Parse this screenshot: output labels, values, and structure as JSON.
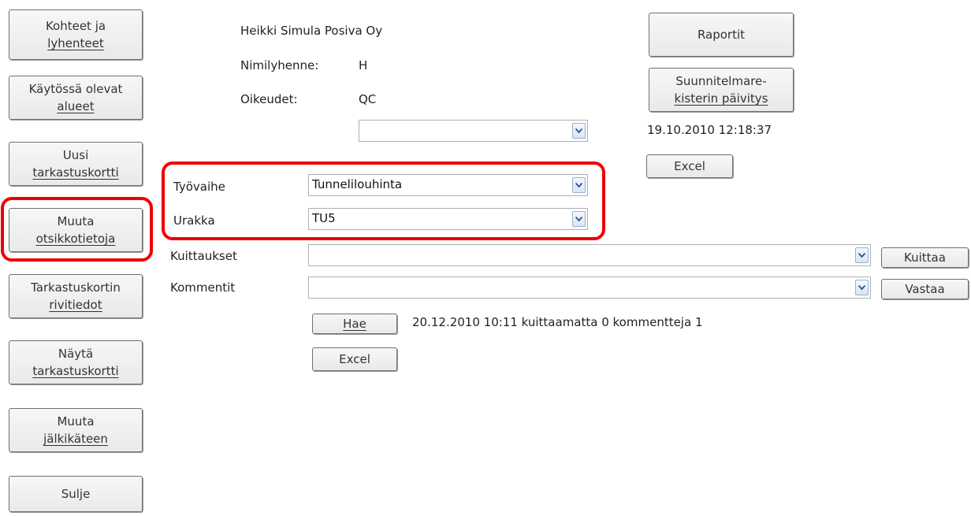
{
  "sidebar": {
    "kohteet": [
      "Kohteet ja",
      "lyhenteet"
    ],
    "kaytossa": [
      "Käytössä olevat",
      "alueet"
    ],
    "uusi": [
      "Uusi",
      "tarkastuskortti"
    ],
    "muuta_otsikko": [
      "Muuta",
      "otsikkotietoja"
    ],
    "rivitiedot": [
      "Tarkastuskortin",
      "rivitiedot"
    ],
    "nayta": [
      "Näytä",
      "tarkastuskortti"
    ],
    "jalkikateen": [
      "Muuta",
      "jälkikäteen"
    ],
    "sulje": "Sulje"
  },
  "user": {
    "name": "Heikki Simula Posiva Oy",
    "initials_label": "Nimilyhenne:",
    "initials_value": "H",
    "rights_label": "Oikeudet:",
    "rights_value": "QC",
    "select_value": ""
  },
  "right": {
    "raportit": "Raportit",
    "suunnitelma": [
      "Suunnitelmare-",
      "kisterin päivitys"
    ],
    "timestamp": "19.10.2010 12:18:37",
    "excel": "Excel"
  },
  "form": {
    "tyovaihe_label": "Työvaihe",
    "tyovaihe_value": "Tunnelilouhinta",
    "urakka_label": "Urakka",
    "urakka_value": "TU5",
    "kuittaukset_label": "Kuittaukset",
    "kuittaukset_value": "",
    "kuittaa_button": "Kuittaa",
    "kommentit_label": "Kommentit",
    "kommentit_value": "",
    "vastaa_button": "Vastaa",
    "hae_button": "Hae",
    "status_text": "20.12.2010 10:11 kuittaamatta 0 kommentteja 1",
    "excel_button": "Excel"
  },
  "colors": {
    "highlight": "#ee0000",
    "button_border": "#6f6f6f"
  }
}
